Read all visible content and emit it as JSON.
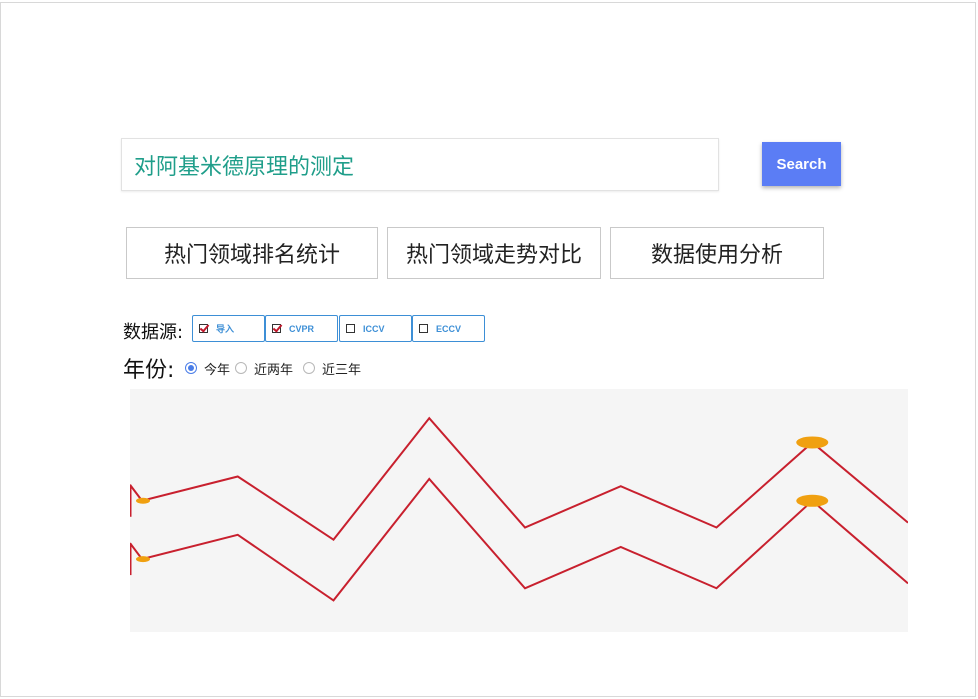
{
  "search": {
    "value": "对阿基米德原理的测定",
    "button_label": "Search"
  },
  "nav": {
    "buttons": [
      {
        "label": "热门领域排名统计"
      },
      {
        "label": "热门领域走势对比"
      },
      {
        "label": "数据使用分析"
      }
    ]
  },
  "datasource": {
    "label": "数据源:",
    "options": [
      {
        "label": "导入",
        "checked": true
      },
      {
        "label": "CVPR",
        "checked": true
      },
      {
        "label": "ICCV",
        "checked": false
      },
      {
        "label": "ECCV",
        "checked": false
      }
    ]
  },
  "year": {
    "label": "年份:",
    "options": [
      {
        "label": "今年",
        "selected": true
      },
      {
        "label": "近两年",
        "selected": false
      },
      {
        "label": "近三年",
        "selected": false
      }
    ]
  },
  "colors": {
    "accent": "#5b7df5",
    "search_text": "#1f9e8a",
    "line": "#c8202e",
    "marker": "#f0a010",
    "chart_bg": "#f5f5f5"
  },
  "chart_data": {
    "type": "line",
    "title": "",
    "xlabel": "",
    "ylabel": "",
    "x": [
      0,
      1,
      2,
      3,
      4,
      5,
      6,
      7,
      8
    ],
    "xlim": [
      0,
      8
    ],
    "ylim": [
      0,
      100
    ],
    "grid": false,
    "series": [
      {
        "values": [
          54,
          64,
          38,
          88,
          43,
          60,
          43,
          78,
          45
        ],
        "markers": [
          0,
          7
        ]
      },
      {
        "values": [
          30,
          40,
          13,
          63,
          18,
          35,
          18,
          54,
          20
        ],
        "markers": [
          0,
          7
        ]
      }
    ]
  }
}
